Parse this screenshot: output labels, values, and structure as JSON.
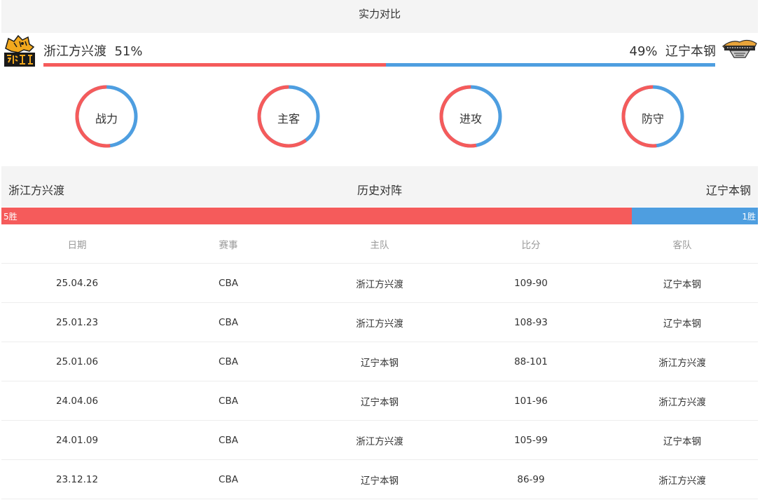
{
  "strength": {
    "title": "实力对比",
    "home": {
      "name": "浙江方兴渡",
      "percent_label": "51%",
      "percent": 51
    },
    "away": {
      "name": "辽宁本钢",
      "percent_label": "49%",
      "percent": 49
    },
    "colors": {
      "home": "#f55b5b",
      "away": "#4e9ee0"
    },
    "donuts": [
      {
        "label": "战力",
        "home_share": 0.52
      },
      {
        "label": "主客",
        "home_share": 0.6
      },
      {
        "label": "进攻",
        "home_share": 0.53
      },
      {
        "label": "防守",
        "home_share": 0.52
      }
    ]
  },
  "history": {
    "title": "历史对阵",
    "home_name": "浙江方兴渡",
    "away_name": "辽宁本钢",
    "home_wins_label": "5胜",
    "away_wins_label": "1胜",
    "home_wins": 5,
    "away_wins": 1,
    "columns": [
      "日期",
      "赛事",
      "主队",
      "比分",
      "客队"
    ],
    "rows": [
      [
        "25.04.26",
        "CBA",
        "浙江方兴渡",
        "109-90",
        "辽宁本钢"
      ],
      [
        "25.01.23",
        "CBA",
        "浙江方兴渡",
        "108-93",
        "辽宁本钢"
      ],
      [
        "25.01.06",
        "CBA",
        "辽宁本钢",
        "88-101",
        "浙江方兴渡"
      ],
      [
        "24.04.06",
        "CBA",
        "辽宁本钢",
        "101-96",
        "浙江方兴渡"
      ],
      [
        "24.01.09",
        "CBA",
        "浙江方兴渡",
        "105-99",
        "辽宁本钢"
      ],
      [
        "23.12.12",
        "CBA",
        "辽宁本钢",
        "86-99",
        "浙江方兴渡"
      ]
    ]
  }
}
